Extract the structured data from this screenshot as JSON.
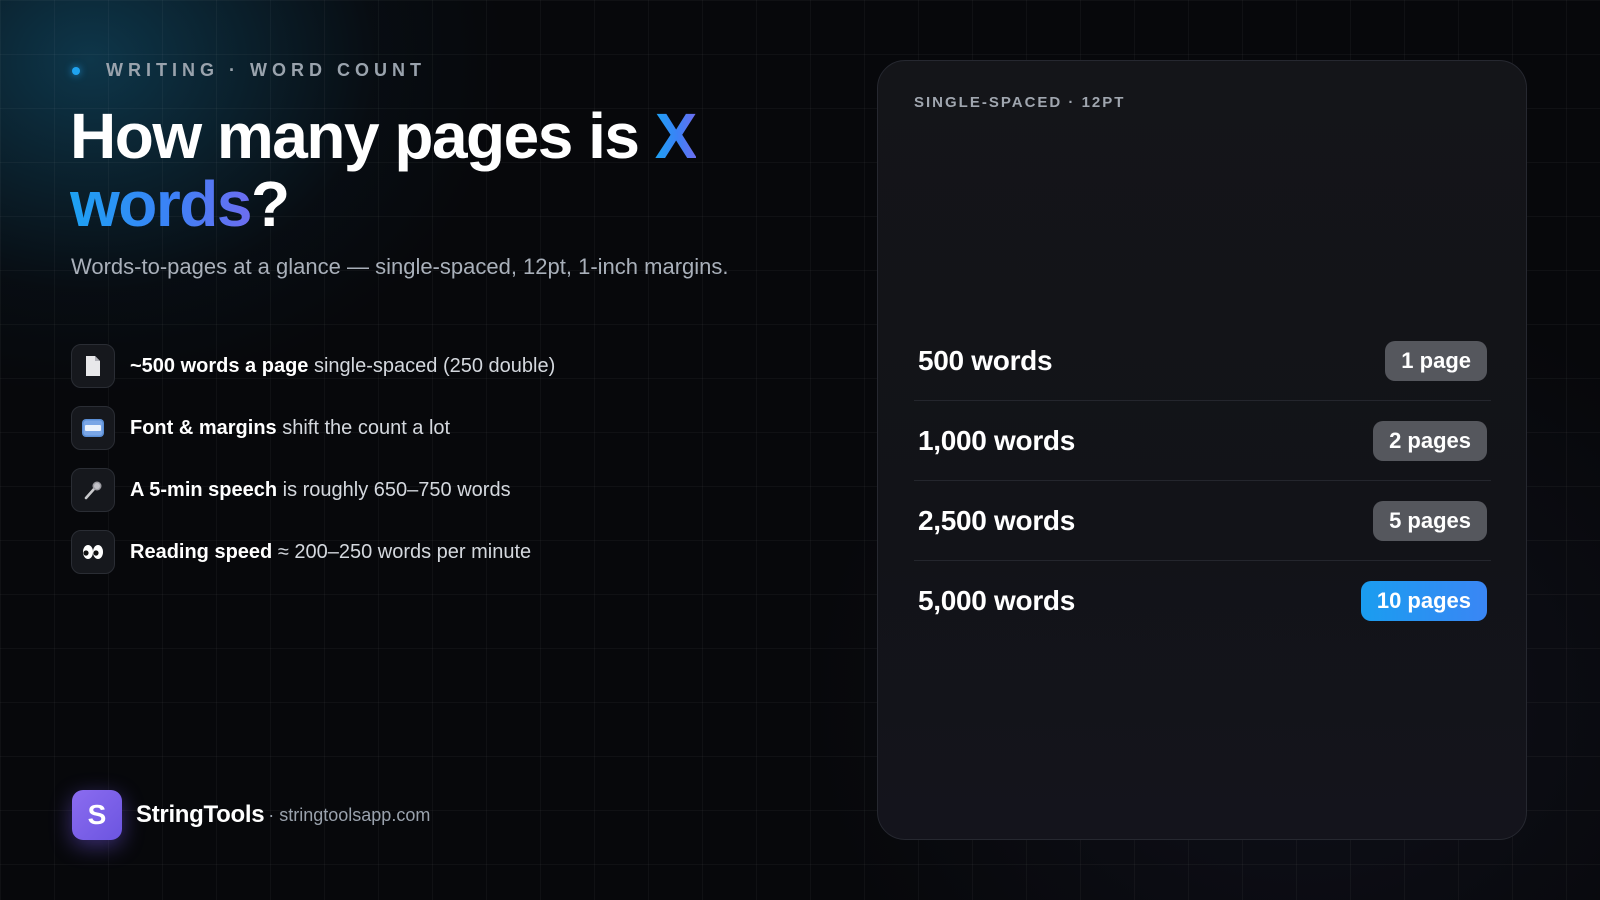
{
  "eyebrow": "WRITING · WORD COUNT",
  "headline": {
    "part1": "How many pages is ",
    "accent1": "X",
    "accent2": "words",
    "end": "?"
  },
  "subhead": "Words-to-pages at a glance — single-spaced, 12pt, 1-inch margins.",
  "facts": [
    {
      "icon": "page-icon",
      "bold": "~500 words a page",
      "rest": " single-spaced (250 double)"
    },
    {
      "icon": "abc-icon",
      "bold": "Font & margins",
      "rest": " shift the count a lot"
    },
    {
      "icon": "microphone-icon",
      "bold": "A 5-min speech",
      "rest": " is roughly 650–750 words"
    },
    {
      "icon": "eyes-icon",
      "bold": "Reading speed",
      "rest": " ≈ 200–250 words per minute"
    }
  ],
  "card": {
    "label": "SINGLE-SPACED · 12PT",
    "rows": [
      {
        "words": "500 words",
        "pages": "1 page"
      },
      {
        "words": "1,000 words",
        "pages": "2 pages"
      },
      {
        "words": "2,500 words",
        "pages": "5 pages"
      },
      {
        "words": "5,000 words",
        "pages": "10 pages"
      }
    ]
  },
  "brand": {
    "logo_letter": "S",
    "name": "StringTools",
    "url": "· stringtoolsapp.com"
  },
  "colors": {
    "accent": "#1da1f2",
    "accent_end": "#6d6df0",
    "logo": "#7c62ea",
    "pill": "#55575d"
  }
}
